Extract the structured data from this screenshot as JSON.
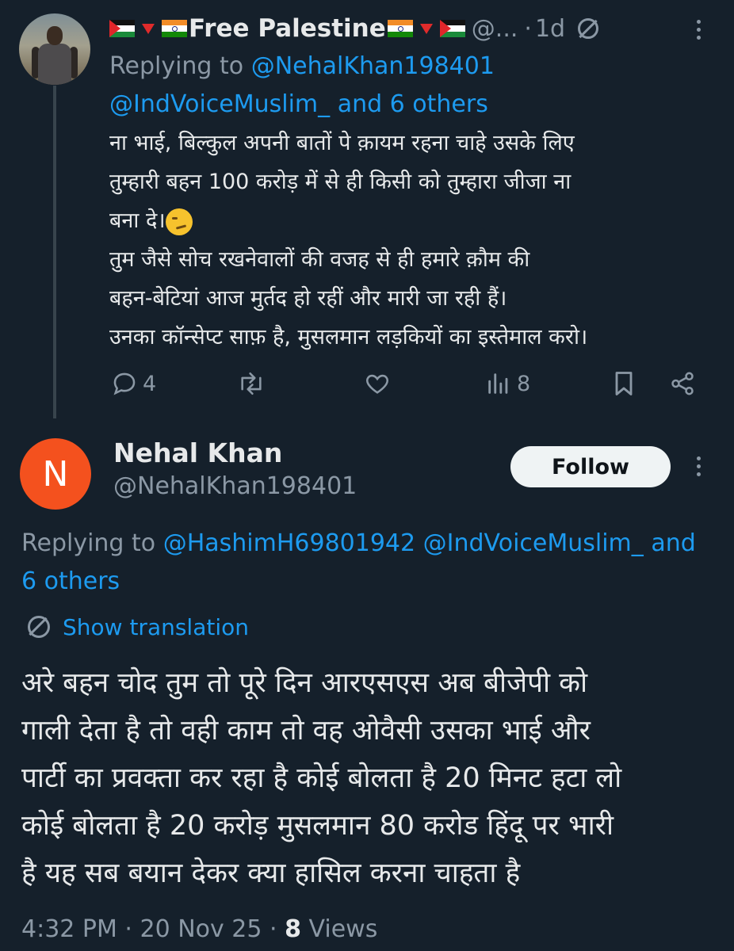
{
  "reply_tweet": {
    "display_name": "Free Palestine",
    "handle_truncated": "@...",
    "time_ago": "1d",
    "replying_prefix": "Replying to",
    "replying_to_1": "@NehalKhan198401",
    "replying_to_2": "@IndVoiceMuslim_ and 6 others",
    "body_lines": [
      "ना भाई, बिल्कुल अपनी बातों पे क़ायम रहना चाहे उसके लिए",
      "तुम्हारी बहन 100 करोड़ में से ही किसी को तुम्हारा जीजा ना",
      "बना दे।",
      "तुम जैसे सोच रखनेवालों की वजह से ही हमारे क़ौम की",
      "बहन-बेटियां आज मुर्तद हो रहीं और मारी जा रही हैं।",
      "उनका कॉन्सेप्ट साफ़ है, मुसलमान लड़कियों का इस्तेमाल करो।"
    ],
    "emoji": "smirking-face",
    "reply_count": "4",
    "views_count": "8"
  },
  "main_tweet": {
    "avatar_letter": "N",
    "name": "Nehal Khan",
    "handle": "@NehalKhan198401",
    "follow_label": "Follow",
    "replying_prefix": "Replying to",
    "replying_to": "@HashimH69801942 @IndVoiceMuslim_ and",
    "replying_to_line2": "6 others",
    "show_translation": "Show translation",
    "body_lines": [
      "अरे बहन चोद तुम तो पूरे दिन आरएसएस अब बीजेपी को",
      "गाली देता है तो वही काम तो वह ओवैसी उसका भाई और",
      "पार्टी का प्रवक्ता कर रहा है कोई बोलता है 20 मिनट हटा लो",
      "कोई बोलता है 20 करोड़ मुसलमान 80 करोड हिंदू पर भारी",
      "है यह सब बयान देकर क्या हासिल करना चाहता है"
    ],
    "timestamp": "4:32 PM · 20 Nov 25 ·",
    "views_count": "8",
    "views_label": "Views"
  },
  "colors": {
    "background": "#15202b",
    "text": "#e7e9ea",
    "muted": "#8b98a5",
    "link": "#1d9bf0",
    "avatar_n": "#f4511e"
  }
}
